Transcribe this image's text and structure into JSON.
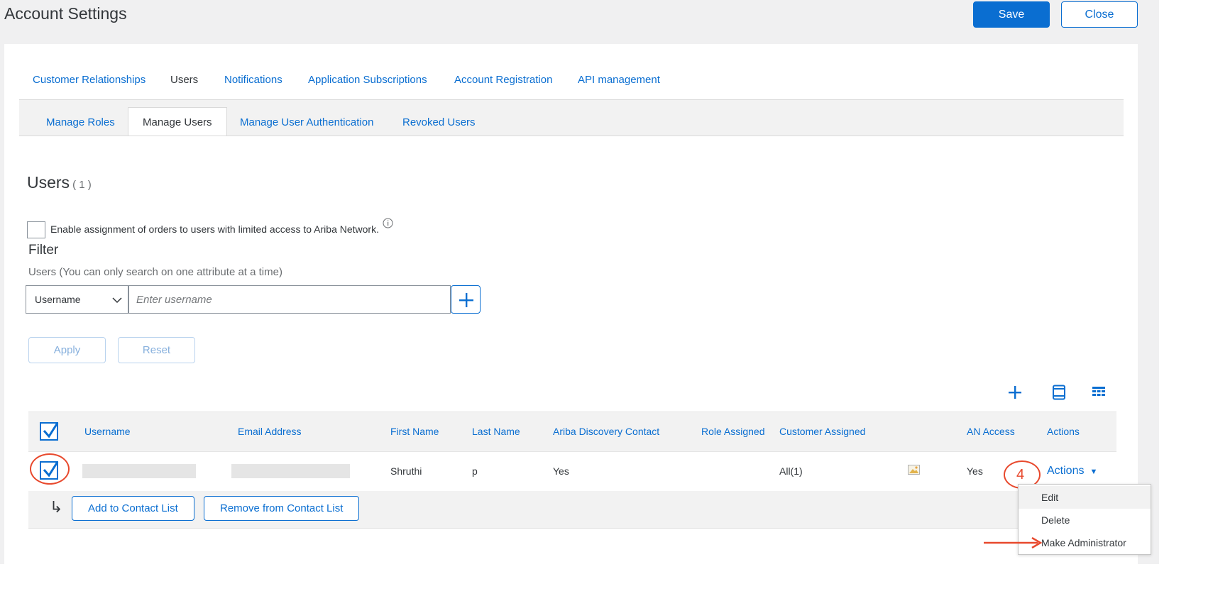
{
  "header": {
    "title": "Account Settings",
    "save_label": "Save",
    "close_label": "Close"
  },
  "main_tabs": [
    {
      "label": "Customer Relationships",
      "active": false
    },
    {
      "label": "Users",
      "active": true
    },
    {
      "label": "Notifications",
      "active": false
    },
    {
      "label": "Application Subscriptions",
      "active": false
    },
    {
      "label": "Account Registration",
      "active": false
    },
    {
      "label": "API management",
      "active": false
    }
  ],
  "sub_tabs": [
    {
      "label": "Manage Roles",
      "active": false
    },
    {
      "label": "Manage Users",
      "active": true
    },
    {
      "label": "Manage User Authentication",
      "active": false
    },
    {
      "label": "Revoked Users",
      "active": false
    }
  ],
  "users": {
    "title": "Users",
    "count": "( 1 )"
  },
  "enable_assignment": {
    "label": "Enable assignment of orders to users with limited access to Ariba Network.",
    "checked": false,
    "info_icon": "info-icon"
  },
  "filter": {
    "title": "Filter",
    "hint": "Users (You can only search on one attribute at a time)",
    "attribute": "Username",
    "placeholder": "Enter username",
    "apply_label": "Apply",
    "reset_label": "Reset"
  },
  "toolbar_icons": [
    "plus-icon",
    "column-icon",
    "table-icon"
  ],
  "table": {
    "columns": [
      "Username",
      "Email Address",
      "First Name",
      "Last Name",
      "Ariba Discovery Contact",
      "Role Assigned",
      "Customer Assigned",
      "AN Access",
      "Actions"
    ],
    "rows": [
      {
        "username": "",
        "email": "",
        "first_name": "Shruthi",
        "last_name": "p",
        "ariba_discovery_contact": "Yes",
        "role_assigned": "",
        "customer_assigned": "All(1)",
        "an_access": "Yes",
        "actions_label": "Actions"
      }
    ]
  },
  "contact_buttons": {
    "add": "Add to Contact List",
    "remove": "Remove from Contact List"
  },
  "actions_menu": [
    "Edit",
    "Delete",
    "Make Administrator"
  ],
  "annotation": {
    "step": "4",
    "color": "#e8492d"
  },
  "colors": {
    "accent": "#0a6ed1",
    "text": "#32363a",
    "annotation": "#e8492d"
  }
}
